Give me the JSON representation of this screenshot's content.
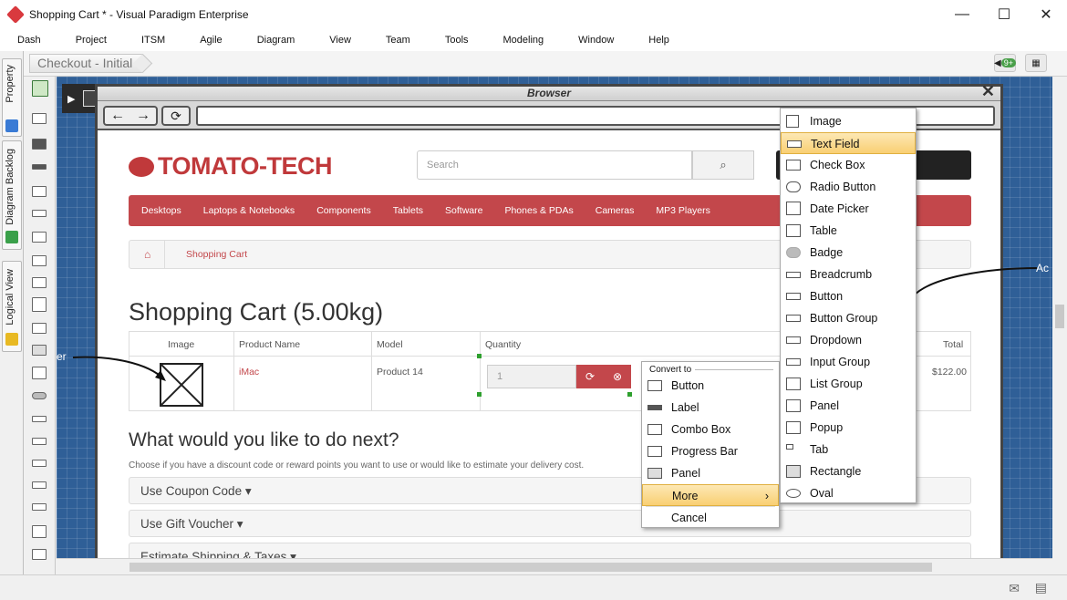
{
  "window": {
    "title": "Shopping Cart * - Visual Paradigm Enterprise",
    "min": "—",
    "max": "☐",
    "close": "✕"
  },
  "menu": [
    "Dash",
    "Project",
    "ITSM",
    "Agile",
    "Diagram",
    "View",
    "Team",
    "Tools",
    "Modeling",
    "Window",
    "Help"
  ],
  "breadcrumb": {
    "current": "Checkout - Initial",
    "notification_count": "9+"
  },
  "side_tabs": [
    "Property",
    "Diagram Backlog",
    "Logical View"
  ],
  "browser": {
    "title": "Browser",
    "close": "✕"
  },
  "site": {
    "logo": "TOMATO-TECH",
    "search_placeholder": "Search",
    "nav": [
      "Desktops",
      "Laptops & Notebooks",
      "Components",
      "Tablets",
      "Software",
      "Phones & PDAs",
      "Cameras",
      "MP3 Players"
    ],
    "breadcrumb_current": "Shopping Cart",
    "heading": "Shopping Cart  (5.00kg)",
    "table": {
      "headers": [
        "Image",
        "Product Name",
        "Model",
        "Quantity",
        "Total"
      ],
      "row": {
        "name": "iMac",
        "model": "Product 14",
        "qty": "1",
        "total": "$122.00"
      }
    },
    "next_heading": "What would you like to do next?",
    "next_sub": "Choose if you have a discount code or reward points you want to use or would like to estimate your delivery cost.",
    "accordion": [
      "Use Coupon Code ▾",
      "Use Gift Voucher ▾",
      "Estimate Shipping & Taxes ▾"
    ]
  },
  "fragments": {
    "left": "er",
    "right": "Ac"
  },
  "convert_menu": {
    "header": "Convert to",
    "items": [
      "Button",
      "Label",
      "Combo Box",
      "Progress Bar",
      "Panel",
      "More",
      "Cancel"
    ],
    "highlighted": "More",
    "more_arrow": "›"
  },
  "more_menu": {
    "items": [
      "Image",
      "Text Field",
      "Check Box",
      "Radio Button",
      "Date Picker",
      "Table",
      "Badge",
      "Breadcrumb",
      "Button",
      "Button Group",
      "Dropdown",
      "Input Group",
      "List Group",
      "Panel",
      "Popup",
      "Tab",
      "Rectangle",
      "Oval"
    ],
    "highlighted": "Text Field"
  },
  "colors": {
    "canvas": "#2f5f97",
    "brand": "#c3474b",
    "highlight": "#f9cf73"
  }
}
